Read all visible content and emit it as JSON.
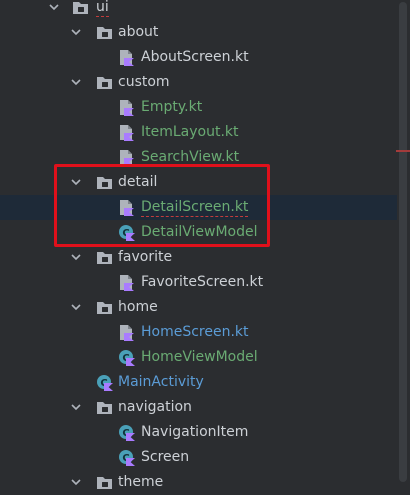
{
  "colors": {
    "background": "#2b2d30",
    "selection": "#1e2a38",
    "text_default": "#cdd1d6",
    "text_green": "#6aab73",
    "text_blue": "#5b9cd6",
    "highlight": "#e0101b"
  },
  "tree": [
    {
      "label": "ui",
      "kind": "folder",
      "depth": 0,
      "expanded": true,
      "color": "default",
      "squiggle": true
    },
    {
      "label": "about",
      "kind": "folder",
      "depth": 1,
      "expanded": true,
      "color": "default"
    },
    {
      "label": "AboutScreen.kt",
      "kind": "kt-file",
      "depth": 2,
      "color": "default"
    },
    {
      "label": "custom",
      "kind": "folder",
      "depth": 1,
      "expanded": true,
      "color": "default"
    },
    {
      "label": "Empty.kt",
      "kind": "kt-file",
      "depth": 2,
      "color": "green"
    },
    {
      "label": "ItemLayout.kt",
      "kind": "kt-file",
      "depth": 2,
      "color": "green"
    },
    {
      "label": "SearchView.kt",
      "kind": "kt-file",
      "depth": 2,
      "color": "green"
    },
    {
      "label": "detail",
      "kind": "folder",
      "depth": 1,
      "expanded": true,
      "color": "default"
    },
    {
      "label": "DetailScreen.kt",
      "kind": "kt-file",
      "depth": 2,
      "color": "green",
      "selected": true,
      "squiggle": true
    },
    {
      "label": "DetailViewModel",
      "kind": "kt-class",
      "depth": 2,
      "color": "green"
    },
    {
      "label": "favorite",
      "kind": "folder",
      "depth": 1,
      "expanded": true,
      "color": "default"
    },
    {
      "label": "FavoriteScreen.kt",
      "kind": "kt-file",
      "depth": 2,
      "color": "default"
    },
    {
      "label": "home",
      "kind": "folder",
      "depth": 1,
      "expanded": true,
      "color": "default"
    },
    {
      "label": "HomeScreen.kt",
      "kind": "kt-file",
      "depth": 2,
      "color": "blue"
    },
    {
      "label": "HomeViewModel",
      "kind": "kt-class",
      "depth": 2,
      "color": "green"
    },
    {
      "label": "MainActivity",
      "kind": "kt-class",
      "depth": 1,
      "color": "blue"
    },
    {
      "label": "navigation",
      "kind": "folder",
      "depth": 1,
      "expanded": true,
      "color": "default"
    },
    {
      "label": "NavigationItem",
      "kind": "kt-class",
      "depth": 2,
      "color": "default"
    },
    {
      "label": "Screen",
      "kind": "kt-class",
      "depth": 2,
      "color": "default"
    },
    {
      "label": "theme",
      "kind": "folder",
      "depth": 1,
      "expanded": true,
      "color": "default"
    }
  ]
}
